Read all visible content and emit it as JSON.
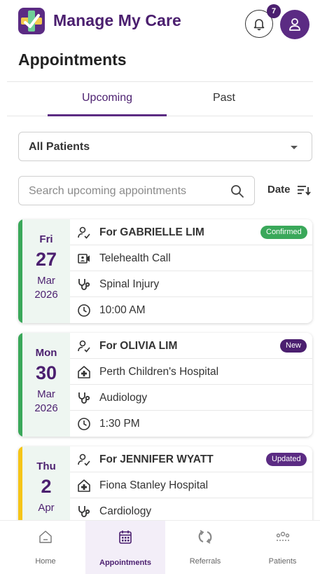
{
  "app": {
    "title": "Manage My Care",
    "notifications": "7"
  },
  "page": {
    "title": "Appointments"
  },
  "tabs": [
    {
      "label": "Upcoming",
      "active": true
    },
    {
      "label": "Past",
      "active": false
    }
  ],
  "filter": {
    "patient_select": "All Patients"
  },
  "search": {
    "placeholder": "Search upcoming appointments",
    "sort_label": "Date"
  },
  "appointments": [
    {
      "dow": "Fri",
      "day": "27",
      "month": "Mar",
      "year": "2026",
      "patient": "For GABRIELLE LIM",
      "status": "Confirmed",
      "status_color": "#3aa85a",
      "stripe": "#3aa85a",
      "location": "Telehealth Call",
      "location_icon": "video-icon",
      "specialty": "Spinal Injury",
      "time": "10:00 AM"
    },
    {
      "dow": "Mon",
      "day": "30",
      "month": "Mar",
      "year": "2026",
      "patient": "For OLIVIA LIM",
      "status": "New",
      "status_color": "#4b1f6f",
      "stripe": "#3aa85a",
      "location": "Perth Children's Hospital",
      "location_icon": "hospital-icon",
      "specialty": "Audiology",
      "time": "1:30 PM"
    },
    {
      "dow": "Thu",
      "day": "2",
      "month": "Apr",
      "year": "",
      "patient": "For JENNIFER WYATT",
      "status": "Updated",
      "status_color": "#5b2b83",
      "stripe": "#f5c518",
      "location": "Fiona Stanley Hospital",
      "location_icon": "hospital-icon",
      "specialty": "Cardiology",
      "time": ""
    }
  ],
  "nav": [
    {
      "label": "Home",
      "icon": "home-icon"
    },
    {
      "label": "Appointments",
      "icon": "calendar-icon",
      "active": true
    },
    {
      "label": "Referrals",
      "icon": "referrals-icon"
    },
    {
      "label": "Patients",
      "icon": "patients-icon"
    }
  ],
  "colors": {
    "brand": "#4b1f6f",
    "accent": "#5b2b83",
    "confirmed": "#3aa85a",
    "updated_stripe": "#f5c518"
  }
}
